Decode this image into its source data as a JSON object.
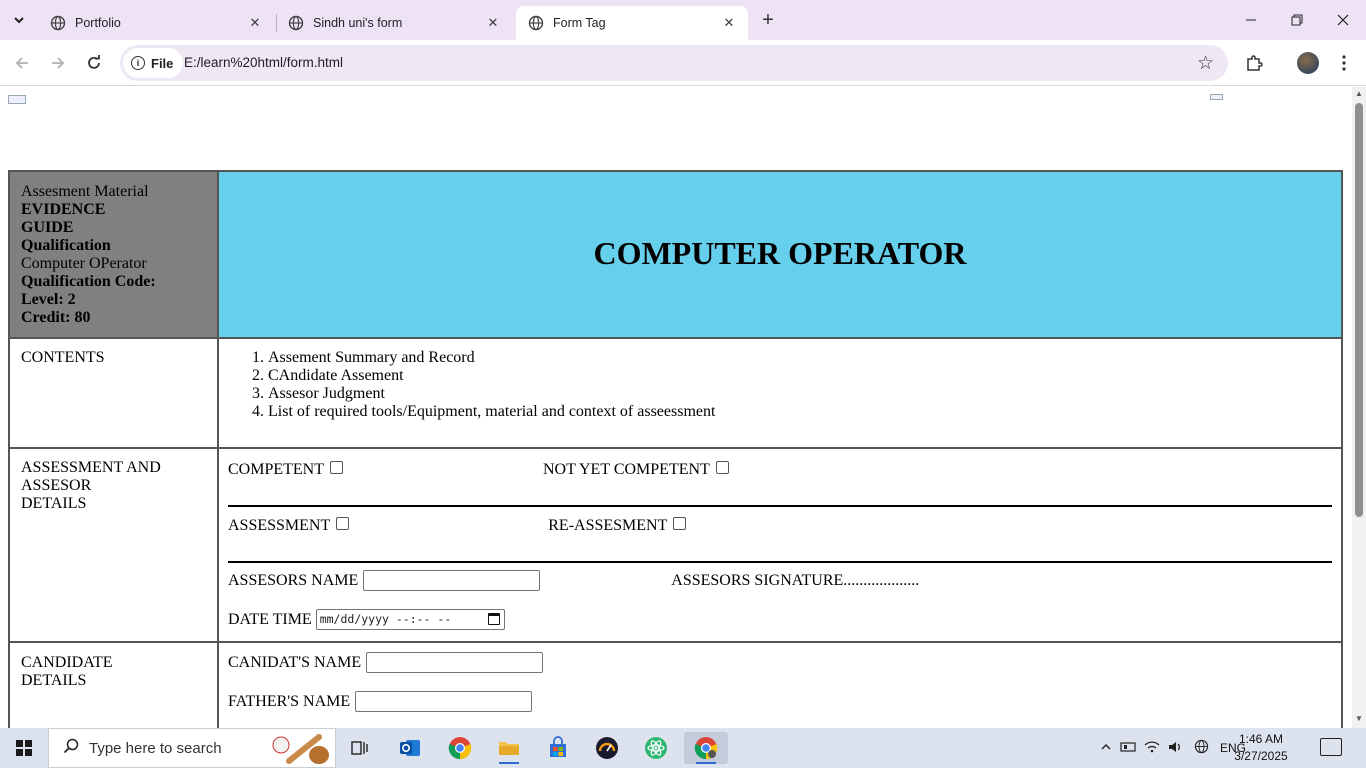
{
  "browser": {
    "tabs": [
      {
        "title": "Portfolio",
        "active": false
      },
      {
        "title": "Sindh uni's form",
        "active": false
      },
      {
        "title": "Form Tag",
        "active": true
      }
    ],
    "address": {
      "scheme_chip": "File",
      "url": "E:/learn%20html/form.html"
    }
  },
  "page": {
    "header": {
      "info_lines": [
        {
          "text": "Assesment Material",
          "bold": false
        },
        {
          "text": "EVIDENCE",
          "bold": true
        },
        {
          "text": "GUIDE",
          "bold": true
        },
        {
          "text": "Qualification",
          "bold": true
        },
        {
          "text": "Computer OPerator",
          "bold": false
        },
        {
          "text": "Qualification Code:",
          "bold": true
        },
        {
          "text": "Level: 2",
          "bold": true
        },
        {
          "text": "Credit: 80",
          "bold": true
        }
      ],
      "title": "COMPUTER OPERATOR",
      "info_bg": "#808080",
      "title_bg": "#66cfeb"
    },
    "contents": {
      "label": "CONTENTS",
      "items": [
        "Assement Summary and Record",
        "CAndidate Assement",
        "Assesor Judgment",
        "List of required tools/Equipment, material and context of asseessment"
      ]
    },
    "assessment": {
      "label_lines": [
        "ASSESSMENT AND",
        "ASSESOR",
        "DETAILS"
      ],
      "competent_label": "COMPETENT",
      "not_yet_competent_label": "NOT YET COMPETENT",
      "assessment_label": "ASSESSMENT",
      "reassessment_label": "RE-ASSESMENT",
      "assessors_name_label": "ASSESORS NAME",
      "assessors_signature_label": "ASSESORS SIGNATURE...................",
      "datetime_label": "DATE TIME",
      "datetime_placeholder": "mm/dd/yyyy --:-- --"
    },
    "candidate": {
      "label_lines": [
        "CANDIDATE",
        "DETAILS"
      ],
      "candidate_name_label": "CANIDAT'S NAME",
      "father_name_label": "FATHER'S NAME"
    }
  },
  "taskbar": {
    "search_placeholder": "Type here to search",
    "apps": [
      "task-view",
      "outlook",
      "chrome",
      "file-explorer",
      "microsoft-store",
      "speedtest",
      "atom",
      "chrome-active"
    ],
    "tray": {
      "language": "ENG",
      "time": "1:46 AM",
      "date": "3/27/2025"
    }
  }
}
